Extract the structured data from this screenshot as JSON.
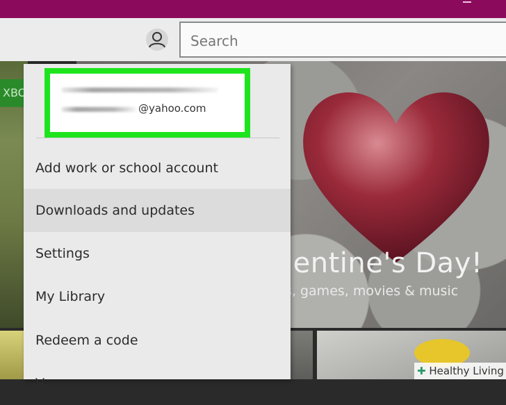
{
  "search": {
    "placeholder": "Search"
  },
  "background": {
    "xbox_badge": "XBO",
    "hero_title": "lentine's Day!",
    "hero_subtitle": "s, games, movies & music"
  },
  "account": {
    "email_domain": "@yahoo.com",
    "highlight_color": "#1ee41e"
  },
  "menu": {
    "items": [
      {
        "label": "Add work or school account"
      },
      {
        "label": "Downloads and updates",
        "highlighted": true
      },
      {
        "label": "Settings"
      },
      {
        "label": "My Library"
      },
      {
        "label": "Redeem a code"
      },
      {
        "label": "V"
      }
    ]
  },
  "watermark": {
    "text": "Healthy Living"
  },
  "colors": {
    "titlebar": "#8c0a5c",
    "menu_bg": "#eaeaea"
  },
  "icons": {
    "account": "user-icon"
  }
}
